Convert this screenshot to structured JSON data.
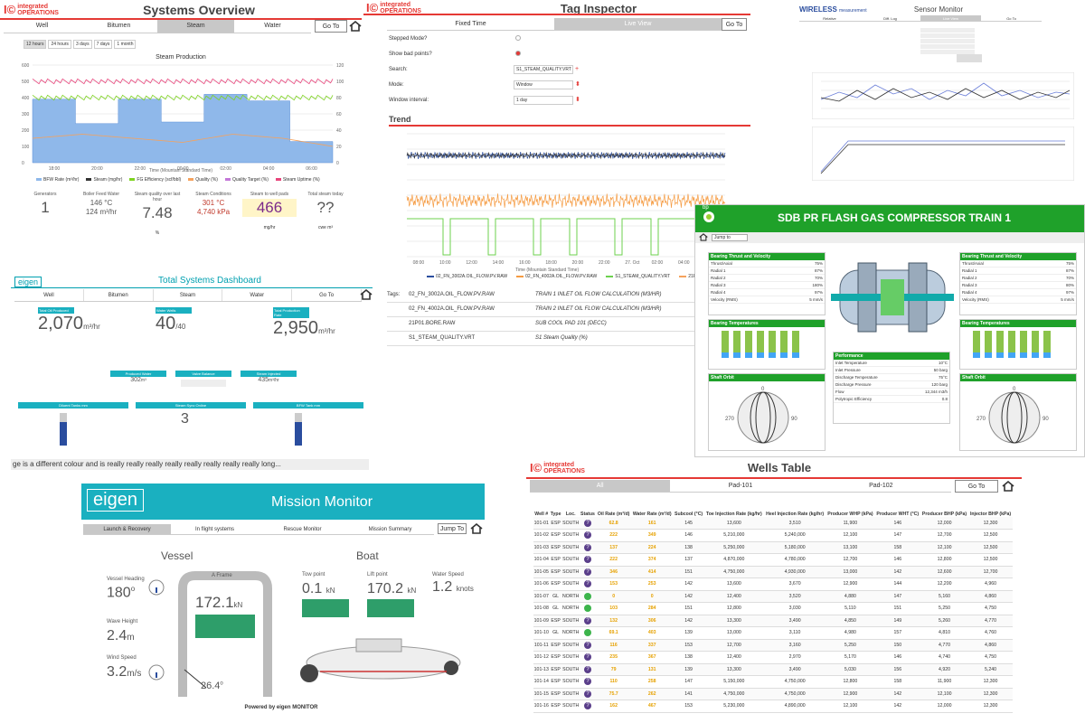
{
  "sys": {
    "title": "Systems Overview",
    "brand_top": "integrated",
    "brand_bot": "OPERATIONS",
    "nav": [
      "Well",
      "Bitumen",
      "Steam",
      "Water"
    ],
    "nav_active": 2,
    "goto": "Go To",
    "ranges": [
      "12 hours",
      "24 hours",
      "3 days",
      "7 days",
      "1 month"
    ],
    "chart_title": "Steam Production",
    "xlabel": "Time (Mountain Standard Time)",
    "legend": [
      "BFW Rate (m³/hr)",
      "Steam (mg/hr)",
      "FG Efficiency (scf/bbl)",
      "Quality (%)",
      "Quality Target (%)",
      "Steam Uptime (%)"
    ],
    "stats": [
      {
        "label": "Generators",
        "value": "1",
        "unit": ""
      },
      {
        "label": "Boiler Feed Water",
        "value": "146 °C\n124 m³/hr",
        "unit": ""
      },
      {
        "label": "Steam quality over last hour",
        "value": "7.48",
        "unit": "%"
      },
      {
        "label": "Steam Conditions",
        "value": "301 °C\n4,740 kPa",
        "unit": ""
      },
      {
        "label": "Steam to well pads",
        "value": "466",
        "unit": "mg/hr"
      },
      {
        "label": "Total steam today",
        "value": "??",
        "unit": "cwe m³"
      }
    ]
  },
  "chart_data": {
    "type": "line",
    "title": "Steam Production",
    "xlabel": "Time (Mountain Standard Time)",
    "categories": [
      "18:00",
      "20:00",
      "22:00",
      "00:00",
      "02:00",
      "04:00",
      "06:00"
    ],
    "ylim": [
      0,
      600
    ],
    "y2lim": [
      0,
      120
    ],
    "series": [
      {
        "name": "BFW Rate (m³/hr)",
        "values": [
          390,
          240,
          390,
          250,
          420,
          380,
          130
        ]
      },
      {
        "name": "Quality (%)",
        "values": [
          100,
          100,
          100,
          100,
          100,
          100,
          100
        ]
      },
      {
        "name": "FG Efficiency (scf/bbl)",
        "values": [
          80,
          80,
          80,
          80,
          80,
          80,
          80
        ]
      },
      {
        "name": "Steam Uptime (%)",
        "values": [
          30,
          35,
          30,
          25,
          35,
          30,
          20
        ]
      }
    ]
  },
  "tag": {
    "title": "Tag Inspector",
    "brand_top": "integrated",
    "brand_bot": "OPERATIONS",
    "nav": [
      "Fixed Time",
      "Live View"
    ],
    "goto": "Go To",
    "fields": [
      {
        "label": "Stepped Mode?",
        "value": ""
      },
      {
        "label": "Show bad points?",
        "value": ""
      },
      {
        "label": "Search:",
        "value": "S1_STEAM_QUALITY.VRT"
      },
      {
        "label": "Mode:",
        "value": "Window"
      },
      {
        "label": "Window interval:",
        "value": "1 day"
      }
    ],
    "trend_title": "Trend",
    "trend_x": [
      "08:00",
      "10:00",
      "12:00",
      "14:00",
      "16:00",
      "18:00",
      "20:00",
      "22:00",
      "27. Oct",
      "02:00",
      "04:00",
      "06:00"
    ],
    "trend_xlabel": "Time (Mountain Standard Time)",
    "legend": [
      "02_FN_3002A.OIL_FLOW.PV.RAW",
      "02_FN_4002A.OIL_FLOW.PV.RAW",
      "S1_STEAM_QUALITY.VRT",
      "21P01.BO"
    ],
    "tags_label": "Tags:",
    "tags": [
      [
        "02_FN_3002A.OIL_FLOW.PV.RAW",
        "TRAIN 1 INLET OIL FLOW CALCULATION (M3/HR)"
      ],
      [
        "02_FN_4002A.OIL_FLOW.PV.RAW",
        "TRAIN 2 INLET OIL FLOW CALCULATION (M3/HR)"
      ],
      [
        "21P01.BORE.RAW",
        "SUB COOL PAD 101 (DECC)"
      ],
      [
        "S1_STEAM_QUALITY.VRT",
        "S1 Steam Quality (%)"
      ]
    ]
  },
  "sensor": {
    "title": "Sensor Monitor",
    "brand": "WIRELESS",
    "brand2": "measurement",
    "nav": [
      "Relative",
      "Diff. Log",
      "Live View",
      "Go To"
    ]
  },
  "tsd": {
    "title": "Total Systems Dashboard",
    "brand": "eigen",
    "nav": [
      "Well",
      "Bitumen",
      "Steam",
      "Water",
      "Go To"
    ],
    "kpis": [
      {
        "label": "Total Oil Produced",
        "value": "2,070",
        "unit": "m³/hr"
      },
      {
        "label": "Water Wells",
        "value": "40",
        "unit": "/40"
      },
      {
        "label": "Total Production Rate",
        "value": "2,950",
        "unit": "m³/hr"
      }
    ],
    "mid": [
      {
        "label": "Produced Water",
        "value": "302",
        "unit": "m³"
      },
      {
        "label": "Valve Balance",
        "value": "",
        "unit": ""
      },
      {
        "label": "Steam Injected",
        "value": "435",
        "unit": "m³/hr"
      }
    ],
    "bars": [
      "Diluent Tanks mm",
      "Steam Sync Online",
      "BFW Tank mm"
    ],
    "counter": "3",
    "ticker": "ge is a different colour and is really really really really really really really really long..."
  },
  "comp": {
    "title": "SDB PR FLASH GAS COMPRESSOR TRAIN 1",
    "jump": "Jump to",
    "brand": "bp",
    "left": {
      "h": "Bearing Thrust and Velocity",
      "rows": [
        [
          "Thrust/Axial",
          "75%"
        ],
        [
          "Radial 1",
          "87%"
        ],
        [
          "Radial 2",
          "70%"
        ],
        [
          "Radial 3",
          "180%"
        ],
        [
          "Radial 4",
          "97%"
        ],
        [
          "Velocity (RMS)",
          "5 mm/s"
        ]
      ],
      "temp": "Bearing Temperatures",
      "orbit": "Shaft Orbit"
    },
    "right": {
      "h": "Bearing Thrust and Velocity",
      "rows": [
        [
          "Thrust/Axial",
          "75%"
        ],
        [
          "Radial 1",
          "87%"
        ],
        [
          "Radial 2",
          "70%"
        ],
        [
          "Radial 3",
          "80%"
        ],
        [
          "Radial 4",
          "97%"
        ],
        [
          "Velocity (RMS)",
          "5 mm/s"
        ]
      ],
      "temp": "Bearing Temperatures",
      "orbit": "Shaft Orbit"
    },
    "perf": {
      "h": "Performance",
      "rows": [
        [
          "Inlet Temperature",
          "10°C"
        ],
        [
          "Inlet Pressure",
          "50 barg"
        ],
        [
          "Discharge Temperature",
          "75°C"
        ],
        [
          "Discharge Pressure",
          "120 barg"
        ],
        [
          "Flow",
          "12,344 m3/h"
        ],
        [
          "Polytropic Efficiency",
          "0.8"
        ]
      ]
    },
    "orbit_labels": [
      "0",
      "90",
      "270"
    ]
  },
  "mission": {
    "brand": "eigen",
    "title": "Mission Monitor",
    "nav": [
      "Launch & Recovery",
      "In flight systems",
      "Rescue Monitor",
      "Mission Summary"
    ],
    "jump": "Jump To",
    "vessel": "Vessel",
    "boat": "Boat",
    "heading_l": "Vessel Heading",
    "heading": "180",
    "wave_l": "Wave Height",
    "wave": "2.4",
    "wave_u": "m",
    "wind_l": "Wind Speed",
    "wind": "3.2",
    "wind_u": "m/s",
    "aframe_l": "A Frame",
    "aframe": "172.1",
    "aframe_u": "kN",
    "angle": "26.4",
    "tow_l": "Tow point",
    "tow": "0.1",
    "tow_u": "kN",
    "lift_l": "Lift point",
    "lift": "170.2",
    "lift_u": "kN",
    "wspd_l": "Water Speed",
    "wspd": "1.2",
    "wspd_u": "knots",
    "footer": "Powered by eigen MONITOR"
  },
  "wells": {
    "title": "Wells Table",
    "brand_top": "integrated",
    "brand_bot": "OPERATIONS",
    "nav": [
      "All",
      "Pad-101",
      "Pad-102"
    ],
    "goto": "Go To",
    "cols": [
      "Well #",
      "Type",
      "Loc.",
      "Status",
      "Oil Rate (m³/d)",
      "Water Rate (m³/d)",
      "Subcool (°C)",
      "Toe Injection Rate (kg/hr)",
      "Heel Injection Rate (kg/hr)",
      "Producer WHP (kPa)",
      "Producer WHT (°C)",
      "Producer BHP (kPa)",
      "Injector BHP (kPa)"
    ],
    "rows": [
      [
        "101-01",
        "ESP",
        "SOUTH",
        "?",
        "62.8",
        "161",
        "145",
        "13,600",
        "3,510",
        "11,900",
        "146",
        "12,000",
        "12,300"
      ],
      [
        "101-02",
        "ESP",
        "SOUTH",
        "?",
        "222",
        "349",
        "146",
        "5,210,000",
        "5,240,000",
        "12,100",
        "147",
        "12,700",
        "12,500"
      ],
      [
        "101-03",
        "ESP",
        "SOUTH",
        "?",
        "137",
        "224",
        "138",
        "5,250,000",
        "5,180,000",
        "13,100",
        "158",
        "12,100",
        "12,500"
      ],
      [
        "101-04",
        "ESP",
        "SOUTH",
        "?",
        "222",
        "374",
        "137",
        "4,870,000",
        "4,780,000",
        "12,700",
        "146",
        "12,800",
        "12,500"
      ],
      [
        "101-05",
        "ESP",
        "SOUTH",
        "?",
        "346",
        "414",
        "151",
        "4,750,000",
        "4,930,000",
        "13,000",
        "142",
        "12,600",
        "12,700"
      ],
      [
        "101-06",
        "ESP",
        "SOUTH",
        "?",
        "153",
        "253",
        "142",
        "13,600",
        "3,670",
        "12,900",
        "144",
        "12,200",
        "4,960"
      ],
      [
        "101-07",
        "GL",
        "NORTH",
        "G",
        "0",
        "0",
        "142",
        "12,400",
        "3,520",
        "4,880",
        "147",
        "5,160",
        "4,860"
      ],
      [
        "101-08",
        "GL",
        "NORTH",
        "G",
        "103",
        "284",
        "151",
        "12,800",
        "3,030",
        "5,110",
        "151",
        "5,250",
        "4,750"
      ],
      [
        "101-09",
        "ESP",
        "SOUTH",
        "?",
        "132",
        "306",
        "142",
        "13,300",
        "3,490",
        "4,850",
        "149",
        "5,260",
        "4,770"
      ],
      [
        "101-10",
        "GL",
        "NORTH",
        "G",
        "69.1",
        "403",
        "139",
        "13,000",
        "3,110",
        "4,980",
        "157",
        "4,810",
        "4,760"
      ],
      [
        "101-11",
        "ESP",
        "SOUTH",
        "?",
        "116",
        "337",
        "153",
        "12,700",
        "3,160",
        "5,250",
        "150",
        "4,770",
        "4,860"
      ],
      [
        "101-12",
        "ESP",
        "SOUTH",
        "?",
        "235",
        "367",
        "138",
        "12,400",
        "2,970",
        "5,170",
        "146",
        "4,740",
        "4,750"
      ],
      [
        "101-13",
        "ESP",
        "SOUTH",
        "?",
        "79",
        "131",
        "139",
        "13,300",
        "3,490",
        "5,030",
        "156",
        "4,920",
        "5,240"
      ],
      [
        "101-14",
        "ESP",
        "SOUTH",
        "?",
        "110",
        "258",
        "147",
        "5,150,000",
        "4,750,000",
        "12,800",
        "158",
        "11,900",
        "12,300"
      ],
      [
        "101-15",
        "ESP",
        "SOUTH",
        "?",
        "75.7",
        "262",
        "141",
        "4,750,000",
        "4,750,000",
        "12,900",
        "142",
        "12,100",
        "12,300"
      ],
      [
        "101-16",
        "ESP",
        "SOUTH",
        "?",
        "162",
        "467",
        "153",
        "5,230,000",
        "4,890,000",
        "12,100",
        "142",
        "12,000",
        "12,300"
      ]
    ]
  }
}
